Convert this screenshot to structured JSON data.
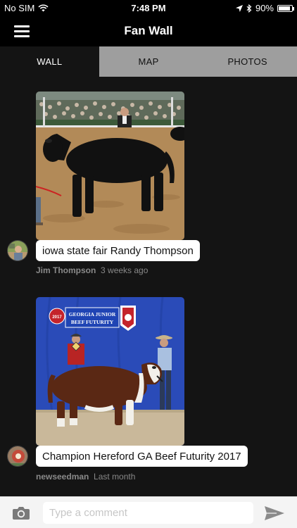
{
  "status_bar": {
    "carrier": "No SIM",
    "time": "7:48 PM",
    "battery": "90%",
    "battery_level": 0.9
  },
  "nav": {
    "title": "Fan Wall"
  },
  "tabs": [
    {
      "label": "WALL",
      "active": true
    },
    {
      "label": "MAP",
      "active": false
    },
    {
      "label": "PHOTOS",
      "active": false
    }
  ],
  "posts": [
    {
      "caption": "iowa state fair Randy Thompson",
      "author": "Jim Thompson",
      "time": "3 weeks ago"
    },
    {
      "caption": "Champion Hereford GA Beef Futurity 2017",
      "author": "newseedman",
      "time": "Last month",
      "banner_year": "2017",
      "banner_line1": "GEORGIA JUNIOR",
      "banner_line2": "BEEF FUTURITY"
    }
  ],
  "comment_bar": {
    "placeholder": "Type a comment"
  }
}
